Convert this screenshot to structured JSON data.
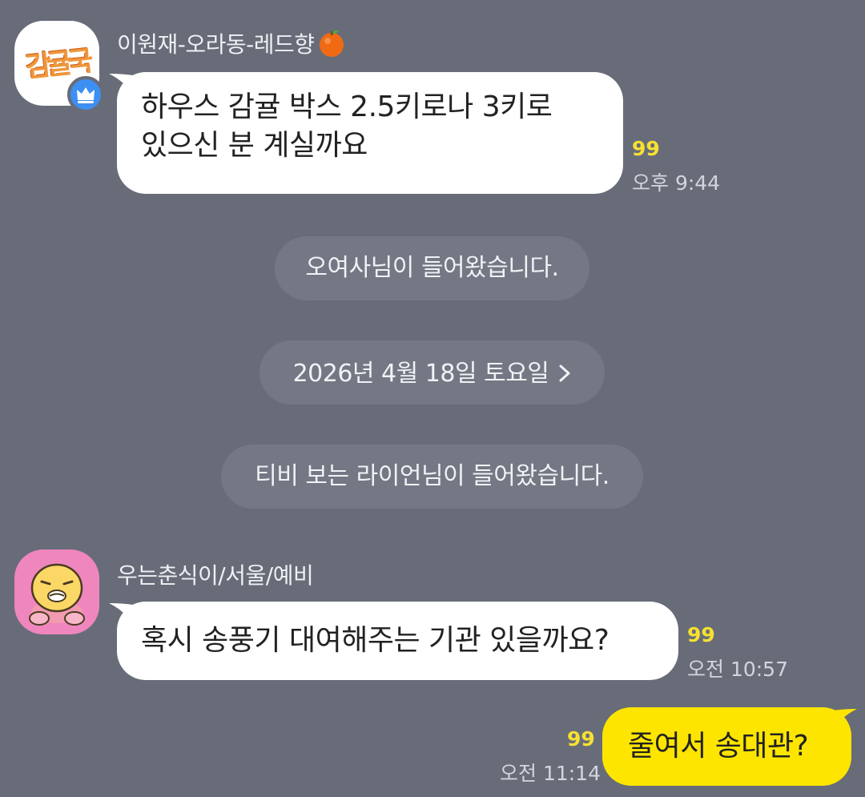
{
  "messages": [
    {
      "sender": "이원재-오라동-레드향",
      "avatar_text": "감귤국",
      "text": "하우스 감귤 박스 2.5키로나 3키로\n있으신 분 계실까요",
      "unread": "99",
      "time": "오후 9:44"
    },
    {
      "sender": "우는춘식이/서울/예비",
      "text": "혹시 송풍기 대여해주는 기관 있을까요?",
      "unread": "99",
      "time": "오전 10:57"
    },
    {
      "text": "줄여서 송대관?",
      "unread": "99",
      "time": "오전 11:14"
    }
  ],
  "notices": {
    "join_1": "오여사님이 들어왔습니다.",
    "date_divider": "2026년 4월 18일 토요일",
    "join_2": "티비 보는 라이언님이 들어왔습니다."
  },
  "icons": {
    "tangerine": "tangerine-icon",
    "crown": "crown-icon",
    "chevron": "chevron-right-icon"
  },
  "colors": {
    "background": "#686c78",
    "bubble_other": "#ffffff",
    "bubble_mine": "#fee500",
    "unread": "#f6e132",
    "crown_badge": "#3d8ff2",
    "notice_bg": "#747884"
  }
}
